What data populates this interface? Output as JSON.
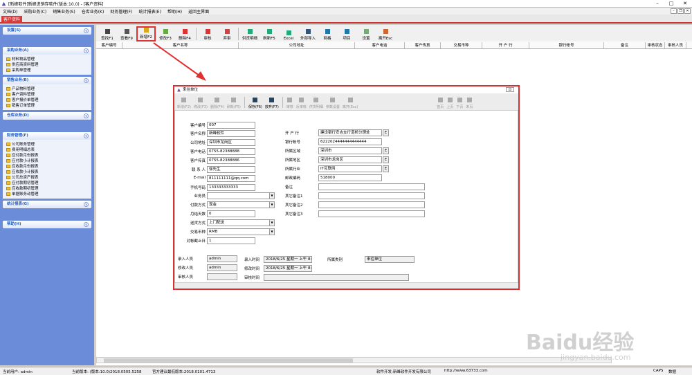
{
  "window": {
    "title": "[新峰软件]新峰进销存软件(版本:10.0) - [客户资料]"
  },
  "menu": [
    "文档(D)",
    "采购业务(C)",
    "销售业务(S)",
    "仓库业务(K)",
    "财务管理(F)",
    "统计报表(E)",
    "帮助(H)",
    "返回主界面"
  ],
  "tab": "客户资料",
  "sidebar": [
    {
      "title": "设置(S)",
      "items": []
    },
    {
      "title": "采购业务(A)",
      "items": [
        "材料物品管理",
        "供应商资料管理",
        "采购单管理"
      ]
    },
    {
      "title": "销售业务(B)",
      "items": [
        "产品物料管理",
        "客户资料管理",
        "客户报价单管理",
        "销售订单管理"
      ]
    },
    {
      "title": "仓库业务(D)",
      "items": []
    },
    {
      "title": "财务管理(F)",
      "items": [
        "公司账务管理",
        "费用明细总表",
        "应付款月份报表",
        "应付款小计报表",
        "应收款月份报表",
        "应收款小计报表",
        "公司总资产报表",
        "应付款期初管理",
        "应收款期初管理",
        "单据账务动管理"
      ]
    },
    {
      "title": "统计报表(G)",
      "items": []
    },
    {
      "title": "帮助(H)",
      "items": []
    }
  ],
  "toolbar": [
    "查找F1",
    "查看F9",
    "新增F2",
    "修改F3",
    "删除F4",
    "审核",
    "弃审",
    "供货明细",
    "刷新F5",
    "Excel",
    "外部导入",
    "网格",
    "项目",
    "设置",
    "离开Esc"
  ],
  "columns": [
    "客户编号",
    "客户名称",
    "公司地址",
    "客户电话",
    "客户传真",
    "交易币种",
    "开 户 行",
    "银行帐号",
    "备注",
    "审核状态",
    "审核人员"
  ],
  "dialog": {
    "title": "来往单位",
    "toolbar": [
      "新增(F2)",
      "修改(F3)",
      "删除(F4)",
      "刷新(F5)",
      "保存(F6)",
      "放弃(F7)",
      "审核",
      "反审核",
      "供货明细",
      "参数设置",
      "离开(Esc)",
      "首页",
      "上页",
      "下页",
      "末页"
    ],
    "left": [
      {
        "label": "客户编号",
        "value": "007"
      },
      {
        "label": "客户名称",
        "value": "新峰软件"
      },
      {
        "label": "公司地址",
        "value": "深圳市龙岗区"
      },
      {
        "label": "客户电话",
        "value": "0755-82388888"
      },
      {
        "label": "客户传真",
        "value": "0755-82388886"
      },
      {
        "label": "联 系 人",
        "value": "徐先生"
      },
      {
        "label": "E-mail",
        "value": "811111111@qq.com"
      },
      {
        "label": "手机号码",
        "value": "133333333333"
      },
      {
        "label": "业务员",
        "value": ""
      },
      {
        "label": "付款方式",
        "value": "现金"
      },
      {
        "label": "月结天数",
        "value": "0"
      },
      {
        "label": "送货方式",
        "value": "上门配送"
      },
      {
        "label": "交易币种",
        "value": "RMB"
      },
      {
        "label": "对帐截止日",
        "value": "1"
      }
    ],
    "right": [
      {
        "label": "开 户 行",
        "value": "建设银行安吉支行道桥分理处"
      },
      {
        "label": "银行帐号",
        "value": "6222024444444444444"
      },
      {
        "label": "所属区域",
        "value": "深圳市"
      },
      {
        "label": "所属地区",
        "value": "深圳市龙岗区"
      },
      {
        "label": "所属行业",
        "value": "IT互联网"
      },
      {
        "label": "邮政编码",
        "value": "518000"
      },
      {
        "label": "备注",
        "value": ""
      },
      {
        "label": "其它备注1",
        "value": ""
      },
      {
        "label": "其它备注2",
        "value": ""
      },
      {
        "label": "其它备注3",
        "value": ""
      }
    ],
    "audit": {
      "entry_label": "录入人员",
      "entry_value": "admin",
      "modify_label": "修改人员",
      "modify_value": "admin",
      "review_label": "审核人员",
      "review_value": "",
      "entry_time_label": "录入时间",
      "entry_time": "2018/6/25 星期一 上午 8:48",
      "modify_time_label": "修改时间",
      "modify_time": "2018/6/25 星期一 上午 8:51",
      "review_time_label": "审核时间",
      "review_time": "",
      "category_label": "所属类别",
      "category": "来往单位"
    }
  },
  "status": {
    "user": "当前用户: admin",
    "version": "当前版本: (版本:10.0)2018.0505.5258",
    "latest": "官方建议最低版本:2018.0101.4713",
    "developer": "软件开发:新峰软件开发有限公司",
    "website": "http://www.63733.com",
    "caps": "CAPS",
    "num": "数据"
  },
  "watermark": {
    "main": "Baidu经验",
    "sub": "jingyan.baidu.com"
  }
}
